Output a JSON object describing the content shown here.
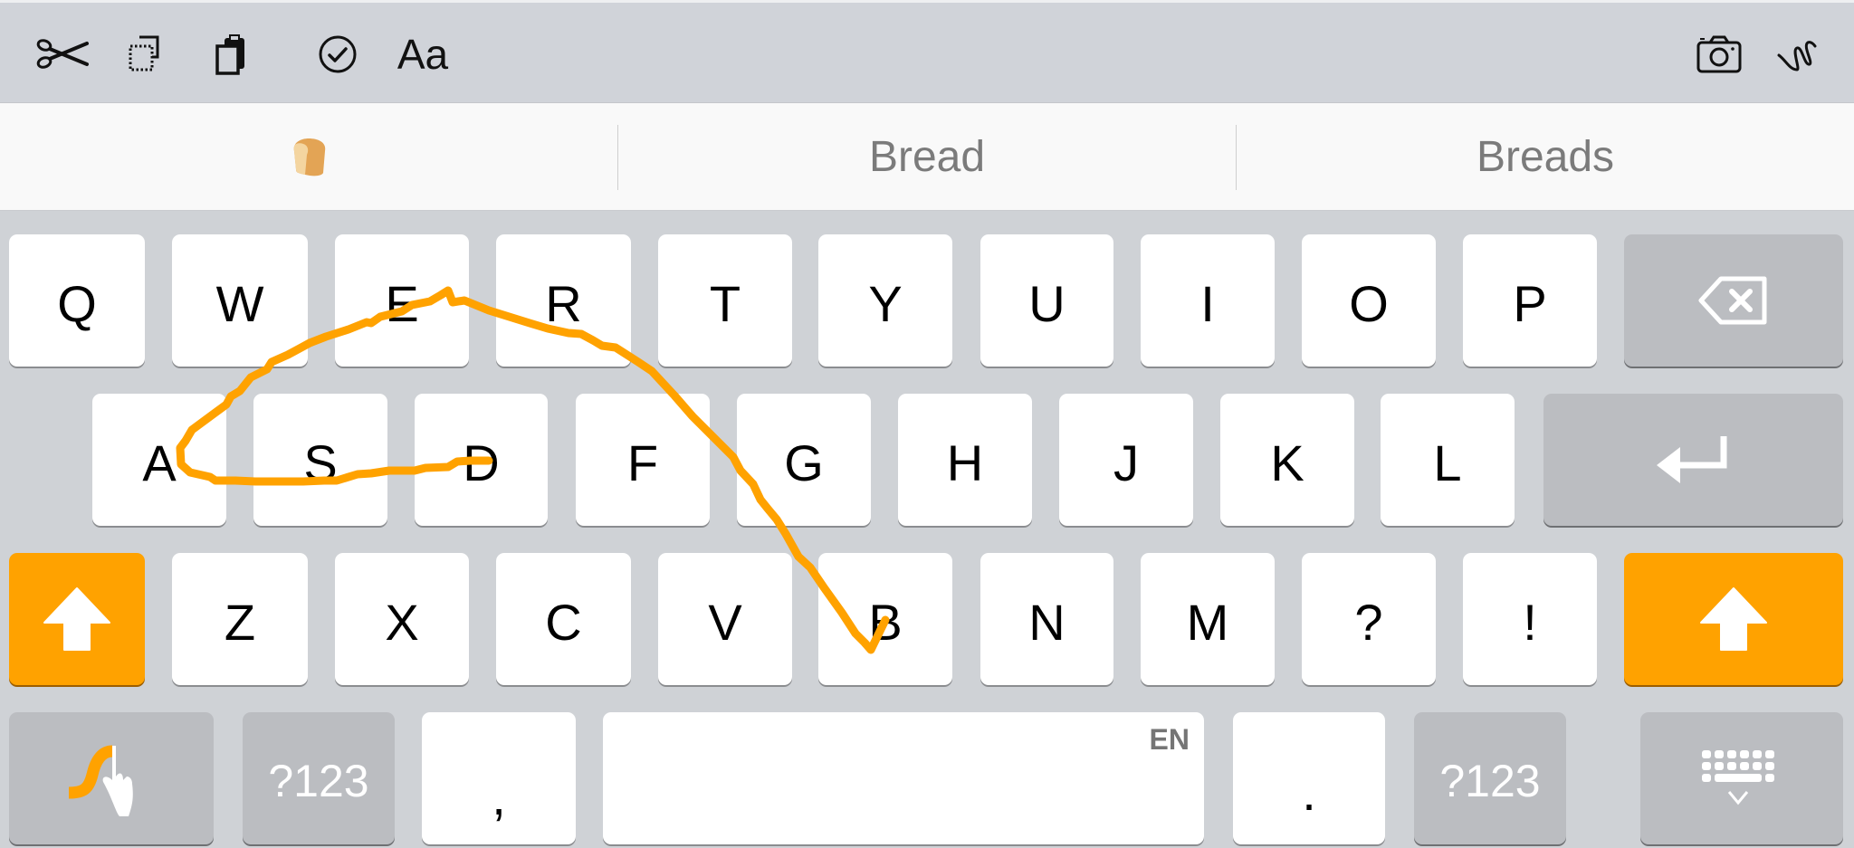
{
  "toolbar": {
    "left_tools": [
      {
        "name": "cut",
        "icon": "scissors-icon"
      },
      {
        "name": "select-all",
        "icon": "select-all-icon"
      },
      {
        "name": "paste",
        "icon": "clipboard-icon"
      },
      {
        "name": "spell-check",
        "icon": "check-circle-icon"
      },
      {
        "name": "text-style",
        "label": "Aa"
      }
    ],
    "right_tools": [
      {
        "name": "camera",
        "icon": "camera-icon"
      },
      {
        "name": "handwriting",
        "icon": "handwriting-squiggle-icon"
      }
    ],
    "text_style_label": "Aa"
  },
  "suggestions": {
    "emoji": "🍞",
    "emoji_name": "bread-emoji",
    "word1": "Bread",
    "word2": "Breads"
  },
  "keyboard": {
    "row1": [
      "Q",
      "W",
      "E",
      "R",
      "T",
      "Y",
      "U",
      "I",
      "O",
      "P"
    ],
    "row2": [
      "A",
      "S",
      "D",
      "F",
      "G",
      "H",
      "J",
      "K",
      "L"
    ],
    "row3": [
      "Z",
      "X",
      "C",
      "V",
      "B",
      "N",
      "M",
      "?",
      "!"
    ],
    "bottom": {
      "symbols_left": "?123",
      "comma": ",",
      "space_language": "EN",
      "period": ".",
      "symbols_right": "?123"
    },
    "shift_state": "active",
    "swipe_word_keys": [
      "B",
      "R",
      "E",
      "A",
      "D"
    ]
  },
  "colors": {
    "accent": "#ffa200",
    "keyboard_bg": "#cfd2d6",
    "function_key": "#bbbdc1",
    "suggestion_text": "#7b7b7b"
  }
}
